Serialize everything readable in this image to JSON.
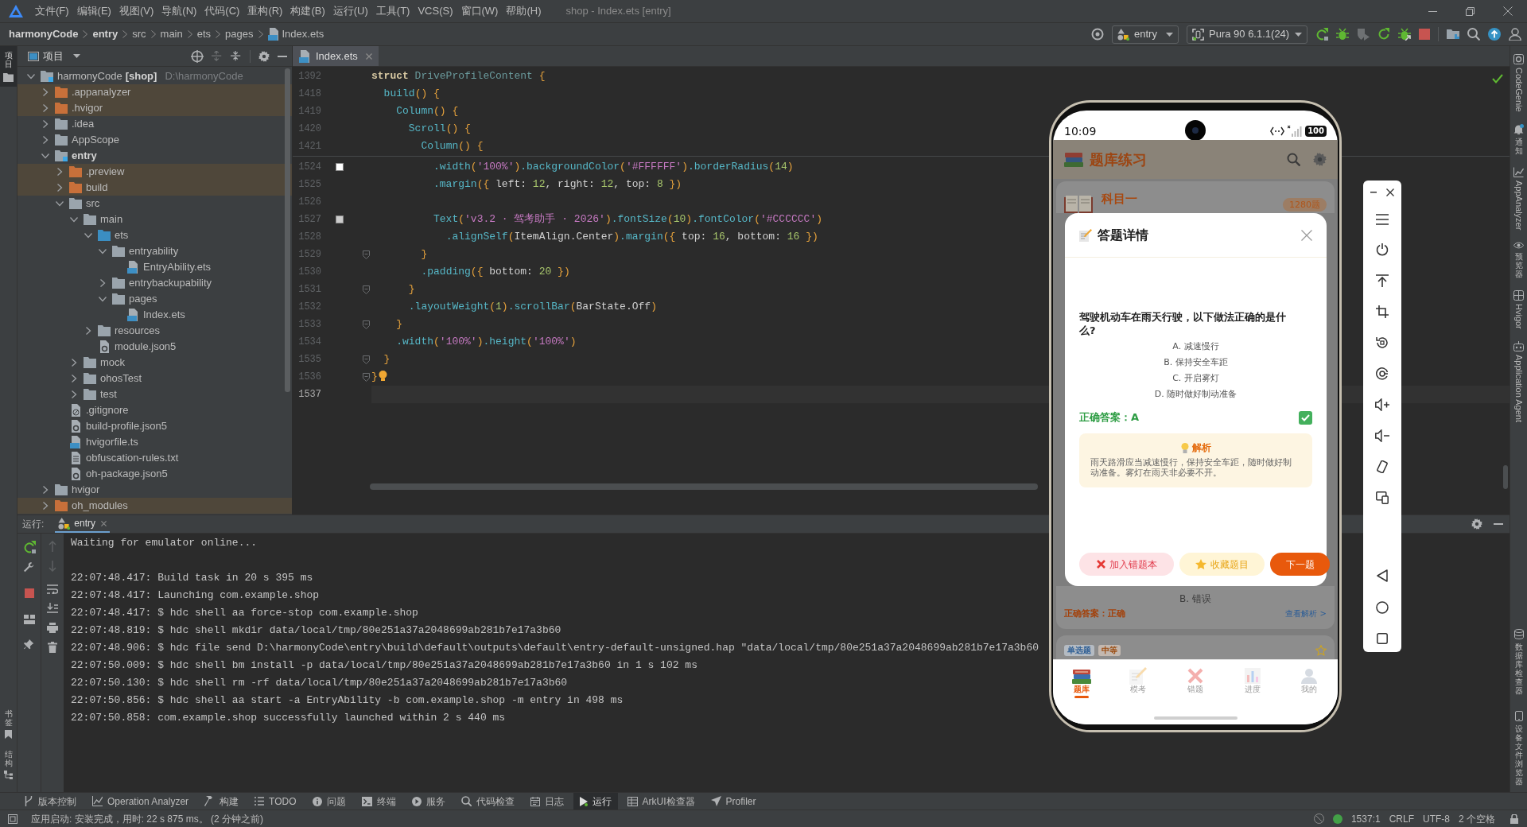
{
  "window": {
    "title": "shop - Index.ets [entry]"
  },
  "menu": [
    "文件(F)",
    "编辑(E)",
    "视图(V)",
    "导航(N)",
    "代码(C)",
    "重构(R)",
    "构建(B)",
    "运行(U)",
    "工具(T)",
    "VCS(S)",
    "窗口(W)",
    "帮助(H)"
  ],
  "breadcrumbs": [
    {
      "label": "harmonyCode",
      "kind": "project"
    },
    {
      "label": "entry",
      "kind": "module"
    },
    {
      "label": "src",
      "kind": "folder"
    },
    {
      "label": "main",
      "kind": "folder"
    },
    {
      "label": "ets",
      "kind": "folder"
    },
    {
      "label": "pages",
      "kind": "folder"
    },
    {
      "label": "Index.ets",
      "kind": "file"
    }
  ],
  "toolbar": {
    "run_config": "entry",
    "device": "Pura 90 6.1.1(24)"
  },
  "left_strip": {
    "top": [
      {
        "label": "项目",
        "selected": true
      }
    ],
    "bottom": [
      {
        "label": "书签",
        "selected": false
      },
      {
        "label": "结构",
        "selected": false
      }
    ]
  },
  "project_panel": {
    "title": "项目",
    "tree": [
      {
        "label": "harmonyCode",
        "tag": "[shop]",
        "path": "D:\\harmonyCode",
        "kind": "project",
        "expanded": true,
        "children": [
          {
            "label": ".appanalyzer",
            "kind": "excluded",
            "expanded": false
          },
          {
            "label": ".hvigor",
            "kind": "excluded",
            "expanded": false
          },
          {
            "label": ".idea",
            "kind": "folder",
            "expanded": false
          },
          {
            "label": "AppScope",
            "kind": "folder",
            "expanded": false
          },
          {
            "label": "entry",
            "kind": "module",
            "expanded": true,
            "children": [
              {
                "label": ".preview",
                "kind": "excluded",
                "expanded": false
              },
              {
                "label": "build",
                "kind": "excluded",
                "expanded": false
              },
              {
                "label": "src",
                "kind": "folder",
                "expanded": true,
                "children": [
                  {
                    "label": "main",
                    "kind": "folder",
                    "expanded": true,
                    "children": [
                      {
                        "label": "ets",
                        "kind": "source",
                        "expanded": true,
                        "children": [
                          {
                            "label": "entryability",
                            "kind": "folder",
                            "expanded": true,
                            "children": [
                              {
                                "label": "EntryAbility.ets",
                                "kind": "ets"
                              }
                            ]
                          },
                          {
                            "label": "entrybackupability",
                            "kind": "folder",
                            "expanded": false
                          },
                          {
                            "label": "pages",
                            "kind": "folder",
                            "expanded": true,
                            "children": [
                              {
                                "label": "Index.ets",
                                "kind": "ets"
                              }
                            ]
                          }
                        ]
                      },
                      {
                        "label": "resources",
                        "kind": "folder",
                        "expanded": false
                      },
                      {
                        "label": "module.json5",
                        "kind": "json"
                      }
                    ]
                  },
                  {
                    "label": "mock",
                    "kind": "folder",
                    "expanded": false
                  },
                  {
                    "label": "ohosTest",
                    "kind": "folder",
                    "expanded": false
                  },
                  {
                    "label": "test",
                    "kind": "folder",
                    "expanded": false
                  }
                ]
              },
              {
                "label": ".gitignore",
                "kind": "gitignore"
              },
              {
                "label": "build-profile.json5",
                "kind": "json"
              },
              {
                "label": "hvigorfile.ts",
                "kind": "ts"
              },
              {
                "label": "obfuscation-rules.txt",
                "kind": "txt"
              },
              {
                "label": "oh-package.json5",
                "kind": "json"
              }
            ]
          },
          {
            "label": "hvigor",
            "kind": "folder",
            "expanded": false
          },
          {
            "label": "oh_modules",
            "kind": "excluded",
            "expanded": false
          }
        ]
      }
    ]
  },
  "editor": {
    "tabs": [
      {
        "label": "Index.ets",
        "selected": true
      }
    ],
    "sticky_lines": [
      {
        "number": "1392",
        "tokens": [
          {
            "kind": "keyword",
            "text": "struct "
          },
          {
            "kind": "type",
            "text": "DriveProfileContent "
          },
          {
            "kind": "brace",
            "text": "{"
          }
        ]
      },
      {
        "number": "1418",
        "tokens": [
          {
            "kind": "call",
            "text": "  build"
          },
          {
            "kind": "brace",
            "text": "() {"
          }
        ]
      },
      {
        "number": "1419",
        "tokens": [
          {
            "kind": "call",
            "text": "    Column"
          },
          {
            "kind": "brace",
            "text": "() {"
          }
        ]
      },
      {
        "number": "1420",
        "tokens": [
          {
            "kind": "call",
            "text": "      Scroll"
          },
          {
            "kind": "brace",
            "text": "() {"
          }
        ]
      },
      {
        "number": "1421",
        "tokens": [
          {
            "kind": "call",
            "text": "        Column"
          },
          {
            "kind": "brace",
            "text": "() {"
          }
        ]
      }
    ],
    "lines": [
      {
        "number": "1524",
        "color": "#ffffff",
        "fold": false,
        "current": false,
        "tokens": [
          {
            "kind": "call",
            "text": "          .width"
          },
          {
            "kind": "brace",
            "text": "("
          },
          {
            "kind": "string",
            "text": "'100%'"
          },
          {
            "kind": "brace",
            "text": ")"
          },
          {
            "kind": "call",
            "text": ".backgroundColor"
          },
          {
            "kind": "brace",
            "text": "("
          },
          {
            "kind": "string",
            "text": "'#FFFFFF'"
          },
          {
            "kind": "brace",
            "text": ")"
          },
          {
            "kind": "call",
            "text": ".borderRadius"
          },
          {
            "kind": "brace",
            "text": "("
          },
          {
            "kind": "number",
            "text": "14"
          },
          {
            "kind": "brace",
            "text": ")"
          }
        ]
      },
      {
        "number": "1525",
        "fold": false,
        "current": false,
        "tokens": [
          {
            "kind": "call",
            "text": "          .margin"
          },
          {
            "kind": "brace",
            "text": "({ "
          },
          {
            "kind": "plain",
            "text": "left: "
          },
          {
            "kind": "number",
            "text": "12"
          },
          {
            "kind": "plain",
            "text": ", right: "
          },
          {
            "kind": "number",
            "text": "12"
          },
          {
            "kind": "plain",
            "text": ", top: "
          },
          {
            "kind": "number",
            "text": "8"
          },
          {
            "kind": "brace",
            "text": " })"
          }
        ]
      },
      {
        "number": "1526",
        "fold": false,
        "current": false
      },
      {
        "number": "1527",
        "color": "#cccccc",
        "fold": false,
        "current": false,
        "tokens": [
          {
            "kind": "call",
            "text": "          Text"
          },
          {
            "kind": "brace",
            "text": "("
          },
          {
            "kind": "string",
            "text": "'v3.2 · 驾考助手 · 2026'"
          },
          {
            "kind": "brace",
            "text": ")"
          },
          {
            "kind": "call",
            "text": ".fontSize"
          },
          {
            "kind": "brace",
            "text": "("
          },
          {
            "kind": "number",
            "text": "10"
          },
          {
            "kind": "brace",
            "text": ")"
          },
          {
            "kind": "call",
            "text": ".fontColor"
          },
          {
            "kind": "brace",
            "text": "("
          },
          {
            "kind": "string",
            "text": "'#CCCCCC'"
          },
          {
            "kind": "brace",
            "text": ")"
          }
        ]
      },
      {
        "number": "1528",
        "fold": false,
        "current": false,
        "tokens": [
          {
            "kind": "call",
            "text": "            .alignSelf"
          },
          {
            "kind": "brace",
            "text": "("
          },
          {
            "kind": "plain",
            "text": "ItemAlign.Center"
          },
          {
            "kind": "brace",
            "text": ")"
          },
          {
            "kind": "call",
            "text": ".margin"
          },
          {
            "kind": "brace",
            "text": "({ "
          },
          {
            "kind": "plain",
            "text": "top: "
          },
          {
            "kind": "number",
            "text": "16"
          },
          {
            "kind": "plain",
            "text": ", bottom: "
          },
          {
            "kind": "number",
            "text": "16"
          },
          {
            "kind": "brace",
            "text": " })"
          }
        ]
      },
      {
        "number": "1529",
        "fold": true,
        "current": false,
        "tokens": [
          {
            "kind": "brace",
            "text": "        }"
          }
        ]
      },
      {
        "number": "1530",
        "fold": false,
        "current": false,
        "tokens": [
          {
            "kind": "call",
            "text": "        .padding"
          },
          {
            "kind": "brace",
            "text": "({ "
          },
          {
            "kind": "plain",
            "text": "bottom: "
          },
          {
            "kind": "number",
            "text": "20"
          },
          {
            "kind": "brace",
            "text": " })"
          }
        ]
      },
      {
        "number": "1531",
        "fold": true,
        "current": false,
        "tokens": [
          {
            "kind": "brace",
            "text": "      }"
          }
        ]
      },
      {
        "number": "1532",
        "fold": false,
        "current": false,
        "tokens": [
          {
            "kind": "call",
            "text": "      .layoutWeight"
          },
          {
            "kind": "brace",
            "text": "("
          },
          {
            "kind": "number",
            "text": "1"
          },
          {
            "kind": "brace",
            "text": ")"
          },
          {
            "kind": "call",
            "text": ".scrollBar"
          },
          {
            "kind": "brace",
            "text": "("
          },
          {
            "kind": "plain",
            "text": "BarState.Off"
          },
          {
            "kind": "brace",
            "text": ")"
          }
        ]
      },
      {
        "number": "1533",
        "fold": true,
        "current": false,
        "tokens": [
          {
            "kind": "brace",
            "text": "    }"
          }
        ]
      },
      {
        "number": "1534",
        "fold": false,
        "current": false,
        "tokens": [
          {
            "kind": "call",
            "text": "    .width"
          },
          {
            "kind": "brace",
            "text": "("
          },
          {
            "kind": "string",
            "text": "'100%'"
          },
          {
            "kind": "brace",
            "text": ")"
          },
          {
            "kind": "call",
            "text": ".height"
          },
          {
            "kind": "brace",
            "text": "("
          },
          {
            "kind": "string",
            "text": "'100%'"
          },
          {
            "kind": "brace",
            "text": ")"
          }
        ]
      },
      {
        "number": "1535",
        "fold": true,
        "current": false,
        "tokens": [
          {
            "kind": "brace",
            "text": "  }"
          }
        ]
      },
      {
        "number": "1536",
        "fold": true,
        "bulb": true,
        "current": false,
        "tokens": [
          {
            "kind": "brace",
            "text": "}"
          }
        ]
      },
      {
        "number": "1537",
        "fold": false,
        "current": true
      }
    ]
  },
  "run_panel": {
    "title": "运行:",
    "tabs": [
      {
        "label": "entry",
        "selected": true
      }
    ],
    "console_blocks": [
      [
        "Waiting for emulator online..."
      ],
      [
        "22:07:48.417: Build task in 20 s 395 ms",
        "22:07:48.417: Launching com.example.shop",
        "22:07:48.417: $ hdc shell aa force-stop com.example.shop",
        "22:07:48.819: $ hdc shell mkdir data/local/tmp/80e251a37a2048699ab281b7e17a3b60",
        "22:07:48.906: $ hdc file send D:\\harmonyCode\\entry\\build\\default\\outputs\\default\\entry-default-unsigned.hap \"data/local/tmp/80e251a37a2048699ab281b7e17a3b60",
        "22:07:50.009: $ hdc shell bm install -p data/local/tmp/80e251a37a2048699ab281b7e17a3b60 in 1 s 102 ms",
        "22:07:50.130: $ hdc shell rm -rf data/local/tmp/80e251a37a2048699ab281b7e17a3b60",
        "22:07:50.856: $ hdc shell aa start -a EntryAbility -b com.example.shop -m entry in 498 ms",
        "22:07:50.858: com.example.shop successfully launched within 2 s 440 ms"
      ]
    ]
  },
  "right_strip": {
    "top": [
      "CodeGenie",
      "通知",
      "AppAnalyzer",
      "预览器",
      "Hvigor",
      "Application Agent"
    ],
    "bottom": [
      "数据库检查器",
      "设备文件浏览器"
    ]
  },
  "tool_windows": [
    {
      "label": "版本控制",
      "selected": false
    },
    {
      "label": "Operation Analyzer",
      "selected": false
    },
    {
      "label": "构建",
      "selected": false
    },
    {
      "label": "TODO",
      "selected": false
    },
    {
      "label": "问题",
      "selected": false
    },
    {
      "label": "终端",
      "selected": false
    },
    {
      "label": "服务",
      "selected": false
    },
    {
      "label": "代码检查",
      "selected": false
    },
    {
      "label": "日志",
      "selected": false
    },
    {
      "label": "运行",
      "selected": true
    },
    {
      "label": "ArkUI检查器",
      "selected": false
    },
    {
      "label": "Profiler",
      "selected": false
    }
  ],
  "status_bar": {
    "message": "应用启动: 安装完成，用时: 22 s 875 ms。 (2 分钟之前)",
    "position": "1537:1",
    "line_ending": "CRLF",
    "encoding": "UTF-8",
    "indent": "2 个空格"
  },
  "emulator": {
    "status_bar": {
      "time": "10:09",
      "battery": "100"
    },
    "app": {
      "title": "题库练习",
      "subject": {
        "title": "科目一",
        "badge": "1280题"
      },
      "question_card": {
        "option": "B. 错误",
        "answer": "正确答案：正确",
        "link": "查看解析 >"
      },
      "next_card": {
        "tags": [
          {
            "label": "单选题",
            "color": "#2f5f95"
          },
          {
            "label": "中等",
            "color": "#9a4a0e"
          }
        ],
        "starred": false
      },
      "tabs": [
        {
          "label": "题库",
          "selected": true
        },
        {
          "label": "模考",
          "selected": false
        },
        {
          "label": "错题",
          "selected": false
        },
        {
          "label": "进度",
          "selected": false
        },
        {
          "label": "我的",
          "selected": false
        }
      ]
    },
    "dialog": {
      "title": "答题详情",
      "question": "驾驶机动车在雨天行驶，以下做法正确的是什么?",
      "options": [
        "A. 减速慢行",
        "B. 保持安全车距",
        "C. 开启雾灯",
        "D. 随时做好制动准备"
      ],
      "answer": "正确答案：A",
      "checked": true,
      "explanation": {
        "title": "解析",
        "text": "雨天路滑应当减速慢行，保持安全车距，随时做好制动准备。雾灯在雨天非必要不开。"
      },
      "buttons": [
        {
          "label": "加入错题本",
          "kind": "danger"
        },
        {
          "label": "收藏题目",
          "kind": "favorite"
        },
        {
          "label": "下一题",
          "kind": "primary"
        }
      ]
    }
  }
}
